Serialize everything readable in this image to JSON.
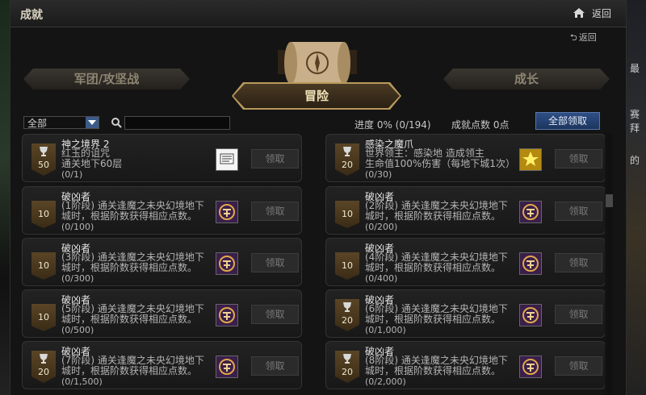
{
  "window": {
    "title": "成就",
    "back_label": "返回",
    "back2_label": "返回"
  },
  "tabs": {
    "left": "军团/攻坚战",
    "main": "冒险",
    "right": "成长"
  },
  "filter": {
    "selected": "全部",
    "search_placeholder": ""
  },
  "summary": {
    "progress": "进度  0% (0/194)",
    "points": "成就点数 0点",
    "claim_all": "全部领取"
  },
  "background_right": [
    "最",
    "赛拜",
    "的"
  ],
  "achievements": [
    {
      "title": "神之境界 2",
      "desc": [
        "红玉的诅咒",
        "通关地下60层"
      ],
      "progress": "(0/1)",
      "points": "50",
      "trophy": true,
      "reward": "scroll",
      "button": "领取"
    },
    {
      "title": "感染之魔爪",
      "desc": [
        "世界领主：感染地        造成领主",
        "生命值100%伤害（每地下城1次）"
      ],
      "progress": "(0/30)",
      "points": "20",
      "trophy": true,
      "reward": "gold",
      "button": "领取"
    },
    {
      "title": "破凶者",
      "desc": [
        "(1阶段) 通关逢魔之未央幻境地下",
        "城时，根据阶数获得相应点数。"
      ],
      "progress": "(0/100)",
      "points": "10",
      "trophy": false,
      "reward": "emblem",
      "button": "领取"
    },
    {
      "title": "破凶者",
      "desc": [
        "(2阶段) 通关逢魔之未央幻境地下",
        "城时，根据阶数获得相应点数。"
      ],
      "progress": "(0/200)",
      "points": "10",
      "trophy": false,
      "reward": "emblem",
      "button": "领取"
    },
    {
      "title": "破凶者",
      "desc": [
        "(3阶段) 通关逢魔之未央幻境地下",
        "城时，根据阶数获得相应点数。"
      ],
      "progress": "(0/300)",
      "points": "10",
      "trophy": false,
      "reward": "emblem",
      "button": "领取"
    },
    {
      "title": "破凶者",
      "desc": [
        "(4阶段) 通关逢魔之未央幻境地下",
        "城时，根据阶数获得相应点数。"
      ],
      "progress": "(0/400)",
      "points": "10",
      "trophy": false,
      "reward": "emblem",
      "button": "领取"
    },
    {
      "title": "破凶者",
      "desc": [
        "(5阶段) 通关逢魔之未央幻境地下",
        "城时，根据阶数获得相应点数。"
      ],
      "progress": "(0/500)",
      "points": "10",
      "trophy": false,
      "reward": "emblem",
      "button": "领取"
    },
    {
      "title": "破凶者",
      "desc": [
        "(6阶段) 通关逢魔之未央幻境地下",
        "城时，根据阶数获得相应点数。"
      ],
      "progress": "(0/1,000)",
      "points": "20",
      "trophy": true,
      "reward": "emblem",
      "button": "领取"
    },
    {
      "title": "破凶者",
      "desc": [
        "(7阶段) 通关逢魔之未央幻境地下",
        "城时，根据阶数获得相应点数。"
      ],
      "progress": "(0/1,500)",
      "points": "20",
      "trophy": true,
      "reward": "emblem",
      "button": "领取"
    },
    {
      "title": "破凶者",
      "desc": [
        "(8阶段) 通关逢魔之未央幻境地下",
        "城时，根据阶数获得相应点数。"
      ],
      "progress": "(0/2,000)",
      "points": "20",
      "trophy": true,
      "reward": "emblem",
      "button": "领取"
    }
  ]
}
